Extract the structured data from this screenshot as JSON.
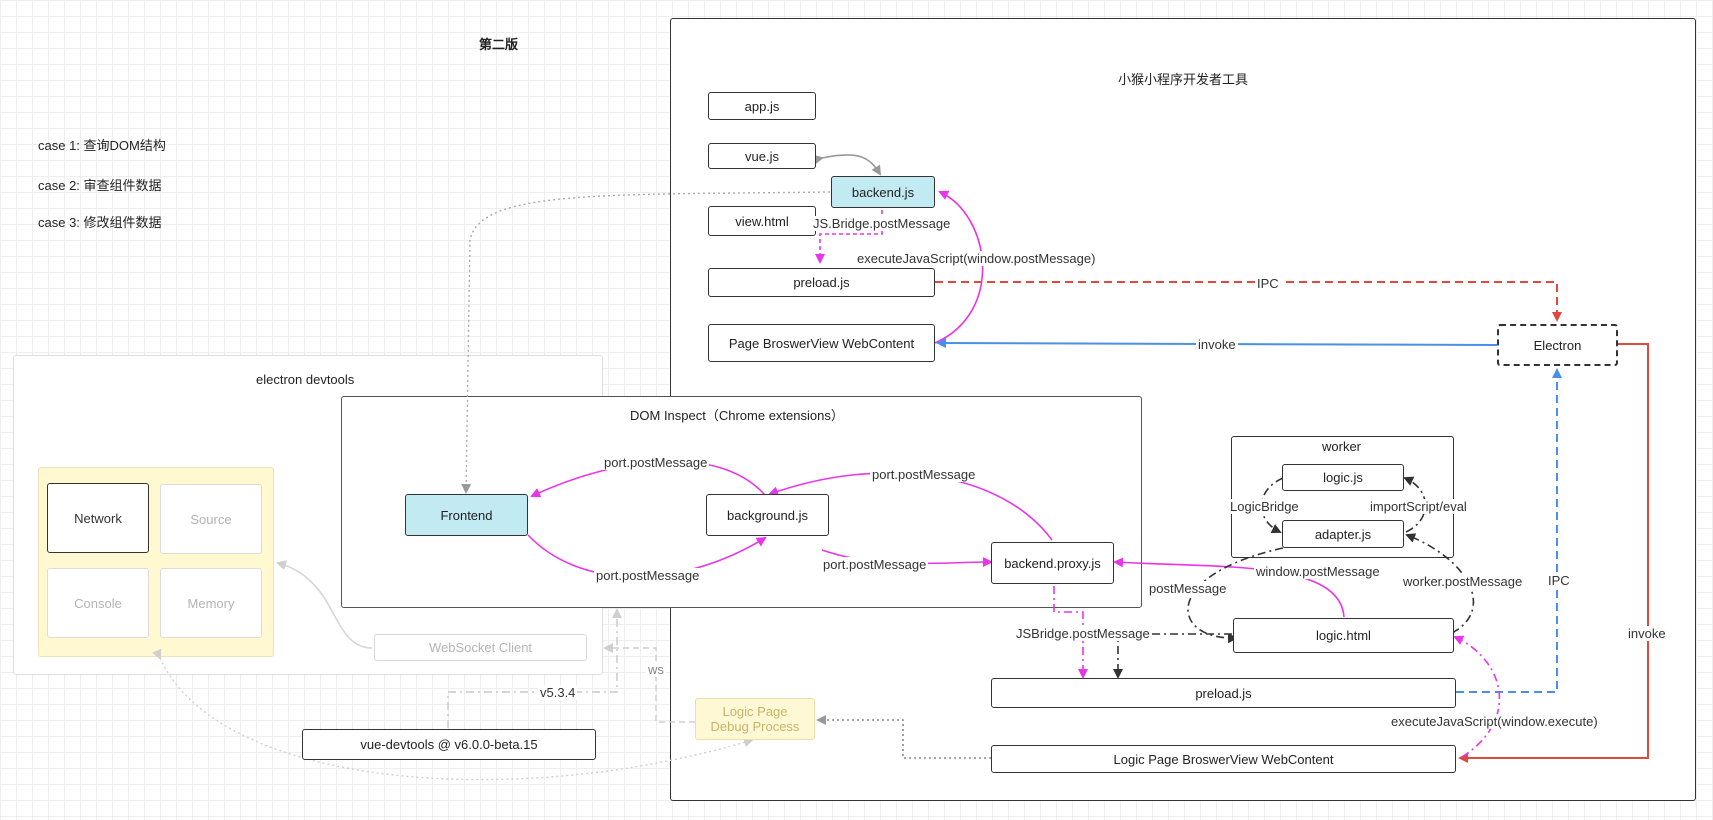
{
  "title": "第二版",
  "cases": [
    "case 1: 查询DOM结构",
    "case 2: 审查组件数据",
    "case 3: 修改组件数据"
  ],
  "containers": {
    "ide_title": "小猴小程序开发者工具",
    "devtools_title": "electron devtools",
    "dom_title": "DOM Inspect（Chrome extensions）",
    "worker_title": "worker"
  },
  "nodes": {
    "app_js": "app.js",
    "vue_js": "vue.js",
    "backend_js": "backend.js",
    "view_html": "view.html",
    "preload_top": "preload.js",
    "page_webcontent": "Page BroswerView WebContent",
    "electron": "Electron",
    "frontend": "Frontend",
    "background_js": "background.js",
    "backend_proxy": "backend.proxy.js",
    "logic_js": "logic.js",
    "adapter_js": "adapter.js",
    "logic_html": "logic.html",
    "preload_bottom": "preload.js",
    "logic_webcontent": "Logic Page BroswerView WebContent",
    "ws_client": "WebSocket Client",
    "logic_debug_line1": "Logic Page",
    "logic_debug_line2": "Debug Process",
    "vue_devtools": "vue-devtools @ v6.0.0-beta.15"
  },
  "tiles": {
    "network": "Network",
    "source": "Source",
    "console": "Console",
    "memory": "Memory"
  },
  "edge_labels": {
    "jsbridge_top": "JS.Bridge.postMessage",
    "execjs_top": "executeJavaScript(window.postMessage)",
    "ipc_top": "IPC",
    "invoke_top": "invoke",
    "port1": "port.postMessage",
    "port2": "port.postMessage",
    "port3": "port.postMessage",
    "port4": "port.postMessage",
    "logicbridge": "LogicBridge",
    "importscript": "importScript/eval",
    "window_post": "window.postMessage",
    "postmessage": "postMessage",
    "worker_post": "worker.postMessage",
    "jsbridge_bottom": "JSBridge.postMessage",
    "ipc_right": "IPC",
    "invoke_right": "invoke",
    "execjs_bottom": "executeJavaScript(window.execute)",
    "ws": "ws",
    "version": "v5.3.4"
  },
  "colors": {
    "magenta": "#e935e9",
    "blue": "#4a8fe8",
    "red": "#e04a3c",
    "gray": "#999999",
    "dark": "#333333",
    "cyan_fill": "#c2eaf2",
    "yellow_fill": "#fff8d0"
  }
}
